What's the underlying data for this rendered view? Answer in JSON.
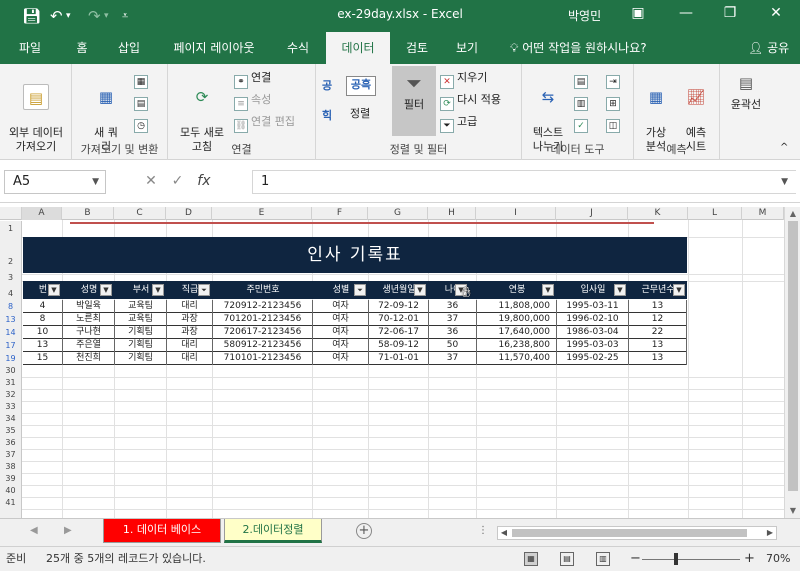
{
  "window": {
    "title": "ex-29day.xlsx - Excel",
    "user": "박영민",
    "save_icon": "save-icon",
    "undo_icon": "undo-icon",
    "redo_icon": "redo-icon"
  },
  "tabs": [
    {
      "label": "파일"
    },
    {
      "label": "홈"
    },
    {
      "label": "삽입"
    },
    {
      "label": "페이지 레이아웃"
    },
    {
      "label": "수식"
    },
    {
      "label": "데이터"
    },
    {
      "label": "검토"
    },
    {
      "label": "보기"
    }
  ],
  "tell_me": "어떤 작업을 원하시나요?",
  "share": "공유",
  "ribbon": {
    "get_external": "외부 데이터\n가져오기",
    "new_query": "새 쿼\n리",
    "group_get_transform": "가져오기 및 변환",
    "refresh_all": "모두 새로\n고침",
    "connections": "연결",
    "properties": "속성",
    "edit_links": "연결 편집",
    "group_connections": "연결",
    "sort_asc": "공",
    "sort_desc": "힉",
    "sort": "정렬",
    "filter": "필터",
    "clear": "지우기",
    "reapply": "다시 적용",
    "advanced": "고급",
    "group_sort_filter": "정렬 및 필터",
    "text_to_columns": "텍스트\n나누기",
    "group_data_tools": "데이터 도구",
    "what_if": "가상\n분석",
    "forecast": "예측\n시트",
    "group_forecast": "예측",
    "outline": "윤곽선"
  },
  "formula_bar": {
    "name_box": "A5",
    "formula": "1"
  },
  "columns": [
    "A",
    "B",
    "C",
    "D",
    "E",
    "F",
    "G",
    "H",
    "I",
    "J",
    "K",
    "L",
    "M"
  ],
  "row_numbers": [
    "1",
    "2",
    "3",
    "4",
    "8",
    "13",
    "14",
    "17",
    "19",
    "30",
    "31",
    "32",
    "33",
    "34",
    "35",
    "36",
    "37",
    "38",
    "39",
    "40",
    "41"
  ],
  "table": {
    "title": "인사 기록표",
    "headers": [
      "번",
      "성명",
      "부서",
      "직급",
      "주민번호",
      "성별",
      "생년월일",
      "나이",
      "연봉",
      "입사일",
      "근무년수"
    ],
    "rows": [
      [
        "4",
        "박일육",
        "교육팀",
        "대리",
        "720912-2123456",
        "여자",
        "72-09-12",
        "36",
        "11,808,000",
        "1995-03-11",
        "13"
      ],
      [
        "8",
        "노른최",
        "교육팀",
        "과장",
        "701201-2123456",
        "여자",
        "70-12-01",
        "37",
        "19,800,000",
        "1996-02-10",
        "12"
      ],
      [
        "10",
        "구나현",
        "기획팀",
        "과장",
        "720617-2123456",
        "여자",
        "72-06-17",
        "36",
        "17,640,000",
        "1986-03-04",
        "22"
      ],
      [
        "13",
        "주은열",
        "기획팀",
        "대리",
        "580912-2123456",
        "여자",
        "58-09-12",
        "50",
        "16,238,800",
        "1995-03-03",
        "13"
      ],
      [
        "15",
        "천진희",
        "기획팀",
        "대리",
        "710101-2123456",
        "여자",
        "71-01-01",
        "37",
        "11,570,400",
        "1995-02-25",
        "13"
      ]
    ]
  },
  "sheets": [
    {
      "label": "1. 데이터 베이스",
      "color": "#ff0000"
    },
    {
      "label": "2.데이터정렬",
      "color": "#ffffc8"
    }
  ],
  "status": {
    "ready": "준비",
    "message": "25개 중 5개의 레코드가 있습니다.",
    "zoom": "70%"
  },
  "colors": {
    "excel_green": "#217346",
    "table_header": "#0f2540"
  }
}
